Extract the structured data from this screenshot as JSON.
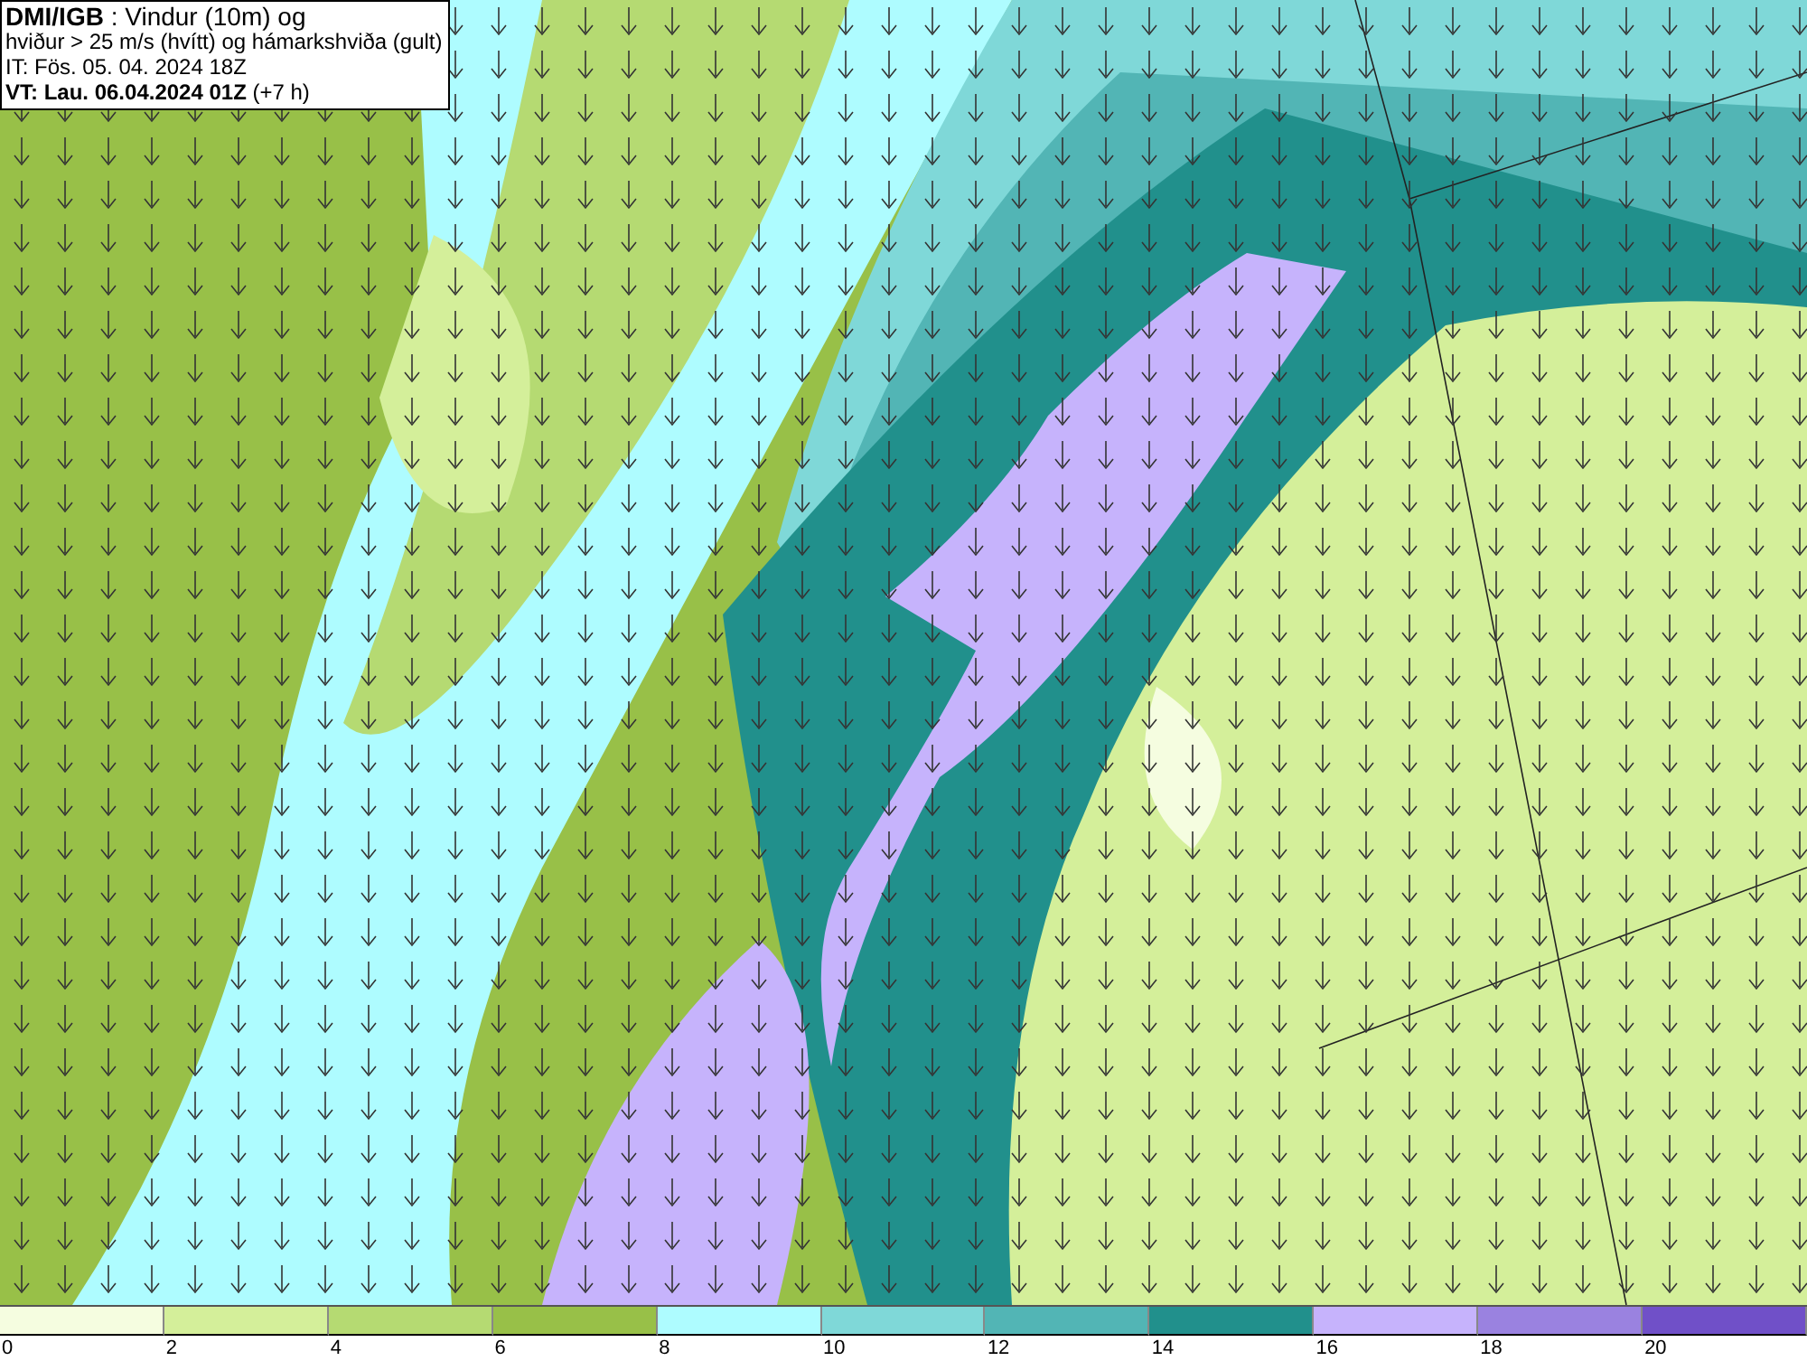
{
  "info": {
    "lines": [
      "**DMI/IGB** : Vindur (10m) og",
      "hviður > 25 m/s (hvítt) og hámarkshviða (gult)",
      "IT: Fös. 05. 04. 2024 18Z",
      "**VT: Lau. 06.04.2024 01Z** (+7 h)"
    ]
  },
  "legend": {
    "bins": [
      {
        "label": "0",
        "color": "#f5fde0"
      },
      {
        "label": "2",
        "color": "#d4ef9a"
      },
      {
        "label": "4",
        "color": "#b5da72"
      },
      {
        "label": "6",
        "color": "#98c048"
      },
      {
        "label": "8",
        "color": "#aefcff"
      },
      {
        "label": "10",
        "color": "#7fd8d8"
      },
      {
        "label": "12",
        "color": "#52b5b5"
      },
      {
        "label": "14",
        "color": "#21908c"
      },
      {
        "label": "16",
        "color": "#c6b3fc"
      },
      {
        "label": "18",
        "color": "#9a82e0"
      },
      {
        "label": "20",
        "color": "#7050c8"
      }
    ]
  }
}
